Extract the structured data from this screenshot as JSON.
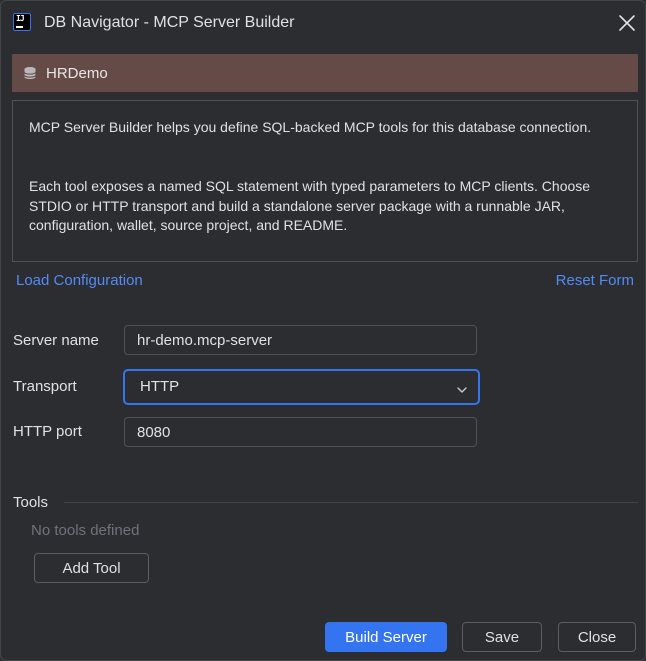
{
  "window": {
    "title": "DB Navigator - MCP Server Builder",
    "logo_text": "IJ"
  },
  "connection": {
    "name": "HRDemo",
    "background": "#654b48"
  },
  "info": {
    "paragraph1": "MCP Server Builder helps you define SQL-backed MCP tools for this database connection.",
    "paragraph2": "Each tool exposes a named SQL statement with typed parameters to MCP clients. Choose STDIO or HTTP transport and build a standalone server package with a runnable JAR, configuration, wallet, source project, and README."
  },
  "links": {
    "load": "Load Configuration",
    "reset": "Reset Form"
  },
  "form": {
    "server_name_label": "Server name",
    "server_name_value": "hr-demo.mcp-server",
    "transport_label": "Transport",
    "transport_value": "HTTP",
    "http_port_label": "HTTP port",
    "http_port_value": "8080"
  },
  "tools": {
    "title": "Tools",
    "empty_text": "No tools defined",
    "add_label": "Add Tool"
  },
  "footer": {
    "build_label": "Build Server",
    "save_label": "Save",
    "close_label": "Close"
  },
  "colors": {
    "accent": "#3574f0",
    "link": "#548af7",
    "background": "#2b2d30"
  }
}
